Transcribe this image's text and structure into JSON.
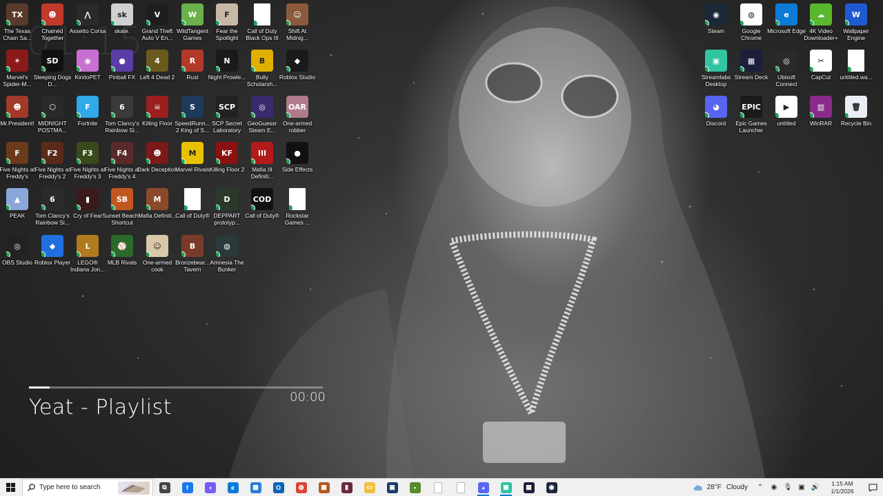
{
  "wallpaper": {
    "ghost_clock": "01:15"
  },
  "desktop_icons": [
    {
      "label": "The Texas Chain Sa...",
      "color": "#5a3a2a",
      "glyph": "TX"
    },
    {
      "label": "Chained Together",
      "color": "#c0392b",
      "glyph": "☻"
    },
    {
      "label": "Assetto Corsa",
      "color": "#2a2a2a",
      "glyph": "⋀"
    },
    {
      "label": "skate.",
      "color": "#d0d0d0",
      "glyph": "sk"
    },
    {
      "label": "Grand Theft Auto V En...",
      "color": "#1e1e1e",
      "glyph": "V"
    },
    {
      "label": "WildTangent Games",
      "color": "#6ab04c",
      "glyph": "W"
    },
    {
      "label": "Fear the Spotlight",
      "color": "#c8b9a6",
      "glyph": "F"
    },
    {
      "label": "Call of Duty Black Ops III",
      "color": "#ffffff",
      "glyph": ""
    },
    {
      "label": "Shift At Midnig...",
      "color": "#8b5a3c",
      "glyph": "☺"
    },
    {
      "label": "Marvel's Spider-M...",
      "color": "#8b1a1a",
      "glyph": "✶"
    },
    {
      "label": "Sleeping Dogs D...",
      "color": "#111111",
      "glyph": "SD"
    },
    {
      "label": "KinitoPET",
      "color": "#c86fd1",
      "glyph": "◉"
    },
    {
      "label": "Pinball FX",
      "color": "#5b3ca8",
      "glyph": "●"
    },
    {
      "label": "Left 4 Dead 2",
      "color": "#6b5a1e",
      "glyph": "4"
    },
    {
      "label": "Rust",
      "color": "#b33a2b",
      "glyph": "R"
    },
    {
      "label": "Night Prowle...",
      "color": "#1a1a1a",
      "glyph": "N"
    },
    {
      "label": "Bully Scholarsh...",
      "color": "#e0b000",
      "glyph": "B"
    },
    {
      "label": "Roblox Studio",
      "color": "#1a1a1a",
      "glyph": "◆"
    },
    {
      "label": "Mr.President!",
      "color": "#a23a2a",
      "glyph": "☻"
    },
    {
      "label": "MIDNIGHT POSTMA...",
      "color": "#2a2a2a",
      "glyph": "⬡"
    },
    {
      "label": "Fortnite",
      "color": "#2fa9e8",
      "glyph": "F"
    },
    {
      "label": "Tom Clancy's Rainbow Si...",
      "color": "#3a3a3a",
      "glyph": "6"
    },
    {
      "label": "Killing Floor",
      "color": "#9b1f1f",
      "glyph": "☠"
    },
    {
      "label": "SpeedRunn... 2 King of S...",
      "color": "#1e3a5a",
      "glyph": "S"
    },
    {
      "label": "SCP Secret Laboratory",
      "color": "#222222",
      "glyph": "SCP"
    },
    {
      "label": "GeoGuessr Steam E...",
      "color": "#3a2a6e",
      "glyph": "◎"
    },
    {
      "label": "One-armed robber",
      "color": "#b07a8a",
      "glyph": "OAR"
    },
    {
      "label": "Five Nights at Freddy's",
      "color": "#6a3a1a",
      "glyph": "F"
    },
    {
      "label": "Five Nights at Freddy's 2",
      "color": "#5a2a1a",
      "glyph": "F2"
    },
    {
      "label": "Five Nights at Freddy's 3",
      "color": "#3a4a1a",
      "glyph": "F3"
    },
    {
      "label": "Five Nights at Freddy's 4",
      "color": "#5a2a2a",
      "glyph": "F4"
    },
    {
      "label": "Dark Deception",
      "color": "#7a1a1a",
      "glyph": "☻"
    },
    {
      "label": "Marvel Rivals",
      "color": "#e8c200",
      "glyph": "M"
    },
    {
      "label": "Killing Floor 2",
      "color": "#8b1212",
      "glyph": "KF"
    },
    {
      "label": "Mafia III Definiti...",
      "color": "#b31b1b",
      "glyph": "III"
    },
    {
      "label": "Side Effects",
      "color": "#111111",
      "glyph": "●"
    },
    {
      "label": "PEAK",
      "color": "#8aa6d8",
      "glyph": "▲"
    },
    {
      "label": "Tom Clancy's Rainbow Si...",
      "color": "#2a2a2a",
      "glyph": "6"
    },
    {
      "label": "Cry of Fear",
      "color": "#3a1a1a",
      "glyph": "▮"
    },
    {
      "label": "Sunset Beach - Shortcut",
      "color": "#c0571e",
      "glyph": "SB"
    },
    {
      "label": "Mafia Definiti...",
      "color": "#8a4a2a",
      "glyph": "M"
    },
    {
      "label": "Call of Duty®",
      "color": "#ffffff",
      "glyph": ""
    },
    {
      "label": "DEPPART prototyp...",
      "color": "#2a3a2a",
      "glyph": "D"
    },
    {
      "label": "Call of Duty®",
      "color": "#111111",
      "glyph": "COD"
    },
    {
      "label": "Rockstar Games ...",
      "color": "#ffffff",
      "glyph": ""
    },
    {
      "label": "OBS Studio",
      "color": "#222222",
      "glyph": "◎"
    },
    {
      "label": "Roblox Player",
      "color": "#1f6fe0",
      "glyph": "◆"
    },
    {
      "label": "LEGO® Indiana Jon...",
      "color": "#b07a1e",
      "glyph": "L"
    },
    {
      "label": "MLB Rivals",
      "color": "#2a6a2a",
      "glyph": "⚾"
    },
    {
      "label": "One-armed cook",
      "color": "#d8c8a8",
      "glyph": "☺"
    },
    {
      "label": "Bronzebear... Tavern",
      "color": "#7a3a2a",
      "glyph": "B"
    },
    {
      "label": "Amnesia The Bunker",
      "color": "#2a3a3a",
      "glyph": "◍"
    },
    {
      "label": "Steam",
      "color": "#1b2838",
      "glyph": "◉"
    },
    {
      "label": "Google Chrome",
      "color": "#ffffff",
      "glyph": "◍"
    },
    {
      "label": "Microsoft Edge",
      "color": "#0c7bd6",
      "glyph": "e"
    },
    {
      "label": "4K Video Downloader+",
      "color": "#5ab82e",
      "glyph": "☁"
    },
    {
      "label": "Wallpaper Engine",
      "color": "#1f5ad0",
      "glyph": "W"
    },
    {
      "label": "Streamlabs Desktop",
      "color": "#31c3a2",
      "glyph": "▣"
    },
    {
      "label": "Stream Deck",
      "color": "#1b1f3a",
      "glyph": "▦"
    },
    {
      "label": "Ubisoft Connect",
      "color": "#2a2a2a",
      "glyph": "◎"
    },
    {
      "label": "CapCut",
      "color": "#ffffff",
      "glyph": "✂"
    },
    {
      "label": "untitled.wa...",
      "color": "#ffffff",
      "glyph": ""
    },
    {
      "label": "Discord",
      "color": "#5865f2",
      "glyph": "◕"
    },
    {
      "label": "Epic Games Launcher",
      "color": "#1a1a1a",
      "glyph": "EPIC"
    },
    {
      "label": "untitled",
      "color": "#ffffff",
      "glyph": "▶"
    },
    {
      "label": "WinRAR",
      "color": "#8a2a8a",
      "glyph": "▥"
    },
    {
      "label": "Recycle Bin",
      "color": "#e8eef4",
      "glyph": "🗑"
    }
  ],
  "player": {
    "title": "Yeat - Playlist",
    "time": "00:00",
    "progress": 0.07
  },
  "taskbar": {
    "search_placeholder": "Type here to search",
    "apps": [
      {
        "name": "task-view",
        "color": "#444444",
        "glyph": "⧉"
      },
      {
        "name": "facebook",
        "color": "#1877f2",
        "glyph": "f"
      },
      {
        "name": "copilot",
        "color": "#7a5af8",
        "glyph": "◑"
      },
      {
        "name": "edge",
        "color": "#0c7bd6",
        "glyph": "e"
      },
      {
        "name": "store",
        "color": "#2a7fd4",
        "glyph": "▦"
      },
      {
        "name": "outlook",
        "color": "#0a64b4",
        "glyph": "O"
      },
      {
        "name": "chrome",
        "color": "#db4437",
        "glyph": "◍"
      },
      {
        "name": "minecraft-dungeons",
        "color": "#b05a1e",
        "glyph": "▩"
      },
      {
        "name": "game-launcher",
        "color": "#6a2a3a",
        "glyph": "▮"
      },
      {
        "name": "file-explorer",
        "color": "#f0c040",
        "glyph": "▭"
      },
      {
        "name": "cmd",
        "color": "#1a3a6a",
        "glyph": "▣"
      },
      {
        "name": "minecraft",
        "color": "#5a8a2a",
        "glyph": "▪"
      },
      {
        "name": "notepad-1",
        "color": "#ffffff",
        "glyph": ""
      },
      {
        "name": "notepad-2",
        "color": "#ffffff",
        "glyph": ""
      },
      {
        "name": "discord",
        "color": "#5865f2",
        "glyph": "◕",
        "active": true
      },
      {
        "name": "streamlabs",
        "color": "#31c3a2",
        "glyph": "▣",
        "active": true
      },
      {
        "name": "stream-deck",
        "color": "#1b1f3a",
        "glyph": "▦"
      },
      {
        "name": "steam",
        "color": "#1b2838",
        "glyph": "◉"
      }
    ],
    "weather": {
      "temp": "28°F",
      "condition": "Cloudy"
    },
    "time": "1:15 AM",
    "date": "1/1/2026"
  }
}
